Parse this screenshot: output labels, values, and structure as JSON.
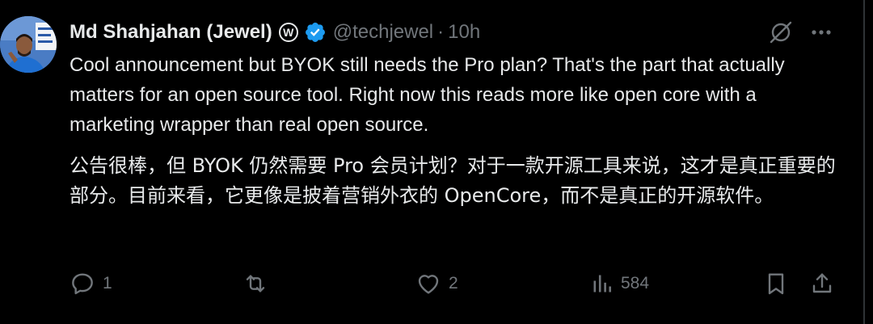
{
  "author": {
    "display_name": "Md Shahjahan (Jewel)",
    "badge_letter": "W",
    "handle": "@techjewel",
    "separator": "·",
    "time": "10h"
  },
  "content": {
    "english": "Cool announcement but BYOK still needs the Pro plan? That's the part that actually matters for an open source tool. Right now this reads more like open core with a marketing wrapper than real open source.",
    "chinese": "公告很棒，但 BYOK 仍然需要 Pro 会员计划？对于一款开源工具来说，这才是真正重要的部分。目前来看，它更像是披着营销外衣的 OpenCore，而不是真正的开源软件。"
  },
  "actions": {
    "replies": "1",
    "reposts": "",
    "likes": "2",
    "views": "584"
  },
  "icons": {
    "top": [
      "grok-icon",
      "more-icon"
    ],
    "bottom": [
      "reply-icon",
      "repost-icon",
      "like-icon",
      "views-icon",
      "bookmark-icon",
      "share-icon"
    ]
  },
  "colors": {
    "background": "#000000",
    "text": "#e7e9ea",
    "secondary": "#71767b",
    "verified": "#1d9bf0"
  }
}
